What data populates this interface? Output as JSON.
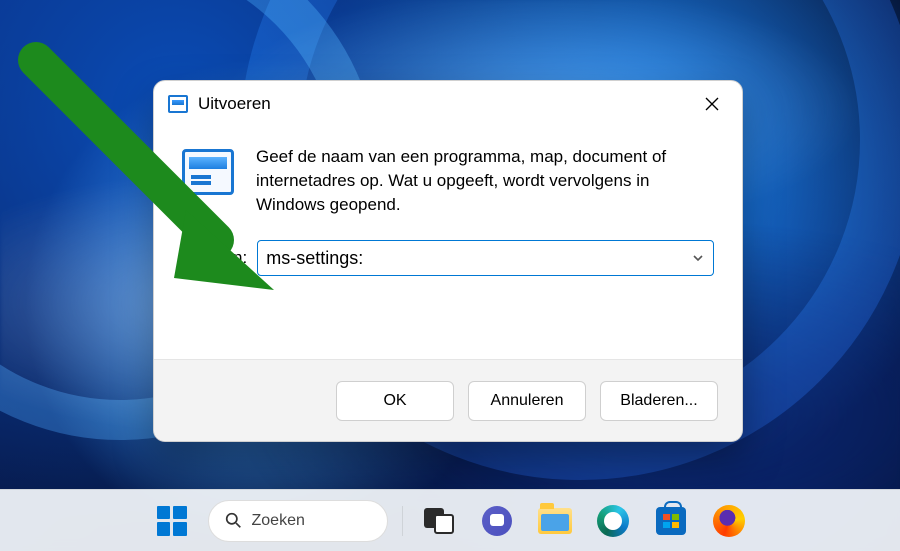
{
  "dialog": {
    "title": "Uitvoeren",
    "message": "Geef de naam van een programma, map, document of internetadres op. Wat u opgeeft, wordt vervolgens in Windows geopend.",
    "open_label": "Openen:",
    "command_value": "ms-settings:",
    "buttons": {
      "ok": "OK",
      "cancel": "Annuleren",
      "browse": "Bladeren..."
    }
  },
  "taskbar": {
    "search_placeholder": "Zoeken"
  }
}
